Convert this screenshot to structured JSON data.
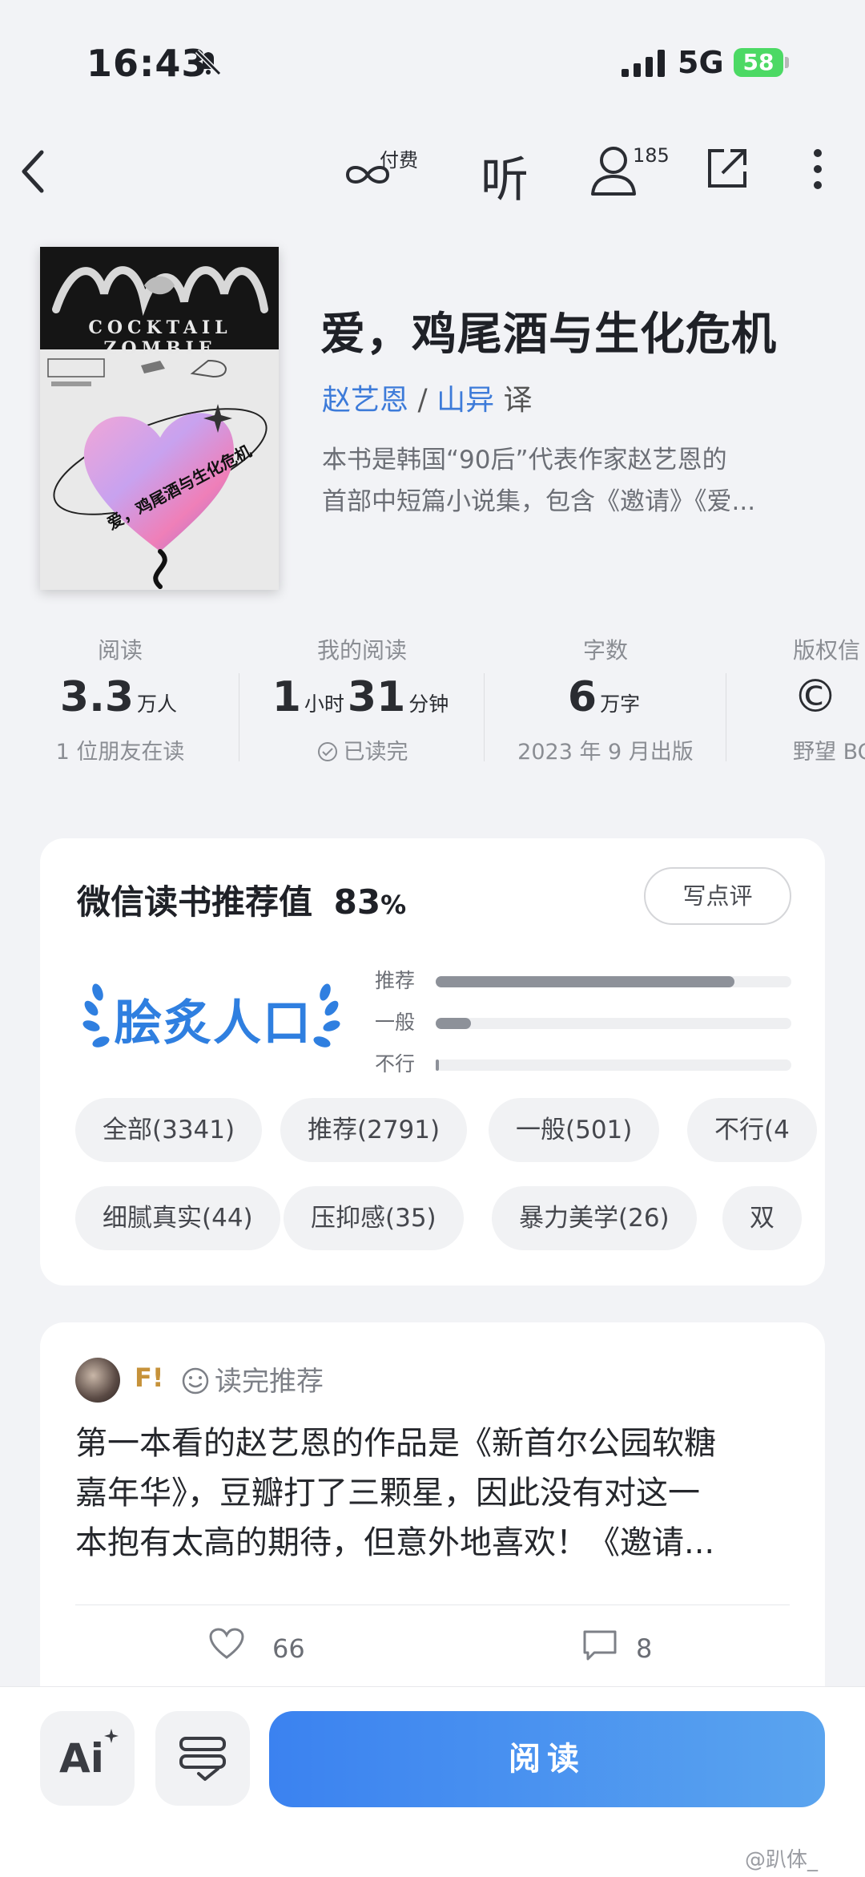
{
  "status_bar": {
    "time": "16:43",
    "network": "5G",
    "battery": "58"
  },
  "top_nav": {
    "pay_label": "付费",
    "listen_label": "听",
    "readers_count": "185"
  },
  "cover": {
    "english_title": "COCKTAIL ZOMBIE",
    "cn_text": "爱，鸡尾酒与生化危机"
  },
  "book": {
    "title": "爱，鸡尾酒与生化危机",
    "author": "赵艺恩",
    "separator": "/",
    "translator": "山异",
    "translator_suffix": "译",
    "desc_line1": "本书是韩国“90后”代表作家赵艺恩的",
    "desc_line2": "首部中短篇小说集，包含《邀请》《爱..."
  },
  "stats": {
    "reads": {
      "label": "阅读",
      "value": "3.3",
      "unit": "万人",
      "sub": "1 位朋友在读"
    },
    "my_read": {
      "label": "我的阅读",
      "hours": "1",
      "hours_unit": "小时",
      "minutes": "31",
      "minutes_unit": "分钟",
      "sub": "已读完"
    },
    "words": {
      "label": "字数",
      "value": "6",
      "unit": "万字",
      "sub": "2023 年 9 月出版"
    },
    "copyright": {
      "label": "版权信",
      "value": "©",
      "sub": "野望 BO"
    }
  },
  "recommend": {
    "title": "微信读书推荐值",
    "score": "83",
    "percent": "%",
    "write_button": "写点评",
    "badge_text": "脍炙人口",
    "bars": [
      {
        "label": "推荐",
        "fraction": 0.84
      },
      {
        "label": "一般",
        "fraction": 0.1
      },
      {
        "label": "不行",
        "fraction": 0.006
      }
    ],
    "filters": [
      "全部(3341)",
      "推荐(2791)",
      "一般(501)",
      "不行(4"
    ],
    "tags": [
      "细腻真实(44)",
      "压抑感(35)",
      "暴力美学(26)",
      "双"
    ]
  },
  "review": {
    "user": "F!",
    "tag": "读完推荐",
    "line1": "第一本看的赵艺恩的作品是《新首尔公园软糖",
    "line2": "嘉年华》，豆瓣打了三颗星，因此没有对这一",
    "line3": "本抱有太高的期待，但意外地喜欢！《邀请...",
    "likes": "66",
    "comments": "8"
  },
  "bottom": {
    "read_button": "阅读",
    "ai_label": "Ai"
  },
  "watermark": "@趴体_"
}
